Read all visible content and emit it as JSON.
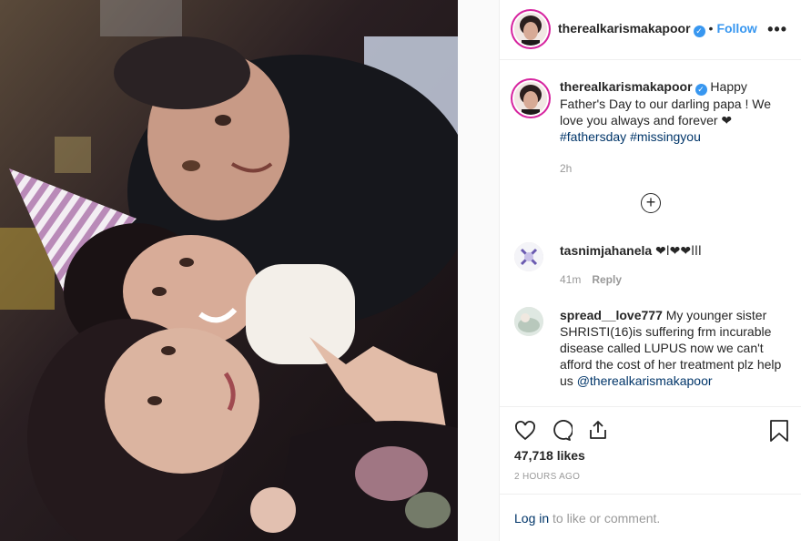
{
  "post": {
    "username": "therealkarismakapoor",
    "verified_mark": "✓",
    "separator": "•",
    "follow_label": "Follow",
    "more_label": "•••"
  },
  "caption": {
    "username": "therealkarismakapoor",
    "text": "Happy Father's Day to our darling papa ! We love you always and forever ❤",
    "hashtags": [
      "#fathersday",
      "#missingyou"
    ],
    "time": "2h"
  },
  "load_more_icon": "plus-circle-icon",
  "load_more_label": "+",
  "comments": [
    {
      "username": "tasnimjahanela",
      "text": "❤𞸀𞸀𞸀❤❤𞸀",
      "time": "41m",
      "reply_label": "Reply"
    },
    {
      "username": "spread__love777",
      "text": "My younger sister SHRISTI(16)is suffering frm incurable disease called LUPUS now we can't afford the cost of her treatment plz help us",
      "mention": "@therealkarismakapoor"
    }
  ],
  "actions": {
    "icons": [
      "heart-icon",
      "comment-icon",
      "share-icon",
      "bookmark-icon"
    ],
    "likes": "47,718 likes",
    "posted": "2 HOURS AGO"
  },
  "login": {
    "link": "Log in",
    "rest": " to like or comment."
  },
  "colors": {
    "accent": "#3897f0",
    "hashtag": "#003569",
    "muted": "#999999",
    "story_ring": "#d6249f"
  }
}
